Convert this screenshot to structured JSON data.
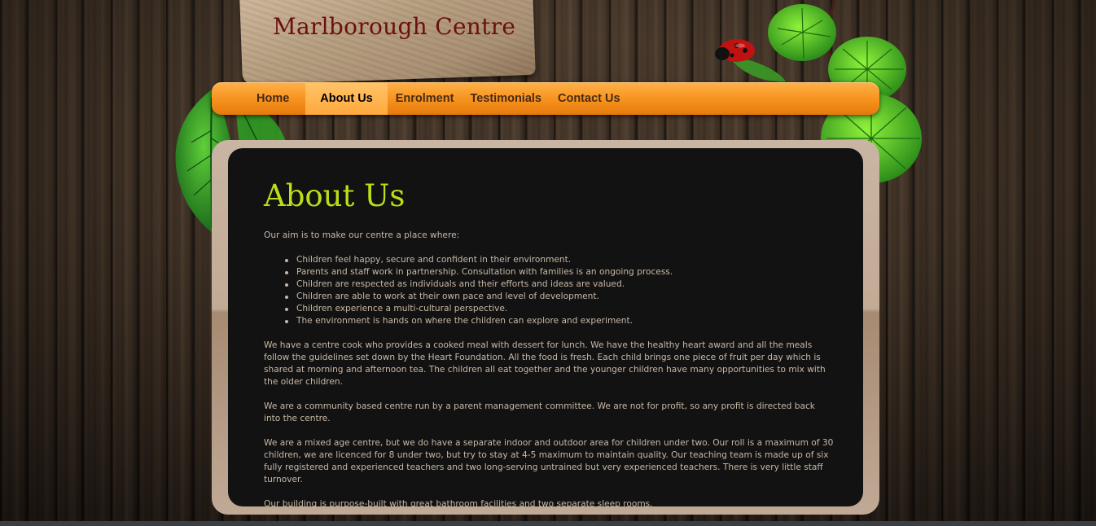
{
  "site": {
    "title": "Marlborough Centre"
  },
  "nav": {
    "items": [
      {
        "label": "Home"
      },
      {
        "label": "About Us"
      },
      {
        "label": "Enrolment"
      },
      {
        "label": "Testimonials"
      },
      {
        "label": "Contact Us"
      }
    ],
    "active": "About Us"
  },
  "page": {
    "heading": "About Us",
    "intro": "Our aim is to make our centre a place where:",
    "aims": [
      "Children feel happy, secure and confident in their environment.",
      "Parents and staff work in partnership. Consultation with families is an ongoing process.",
      "Children are respected as individuals and their efforts and ideas are valued.",
      "Children are able to work at their own pace and level of development.",
      "Children experience a multi-cultural perspective.",
      "The environment is hands on where the children can explore and experiment."
    ],
    "paragraphs": [
      "We have a centre cook who provides a cooked meal with dessert for lunch. We have the healthy heart award and all the meals follow the guidelines set down by the Heart Foundation. All the food is fresh. Each child brings one piece of fruit per day which is shared at morning and afternoon tea. The children all eat together and the younger children have many opportunities to mix with the older children.",
      "We are a community based centre run by a parent management committee. We are not for profit, so any profit is directed back into the centre.",
      "We are a mixed age centre, but we do have a separate indoor and outdoor area for children under two. Our roll is a maximum of 30 children, we are licenced for 8 under two, but try to stay at 4-5 maximum to maintain quality. Our teaching team is made up of six fully registered and experienced teachers and two long-serving untrained but very experienced teachers. There is very little staff turnover.",
      "Our building is purpose-built with great bathroom facilities and two separate sleep rooms."
    ]
  },
  "colors": {
    "heading": "#b9e016",
    "nav": "#f79420",
    "title": "#6b0f10"
  }
}
